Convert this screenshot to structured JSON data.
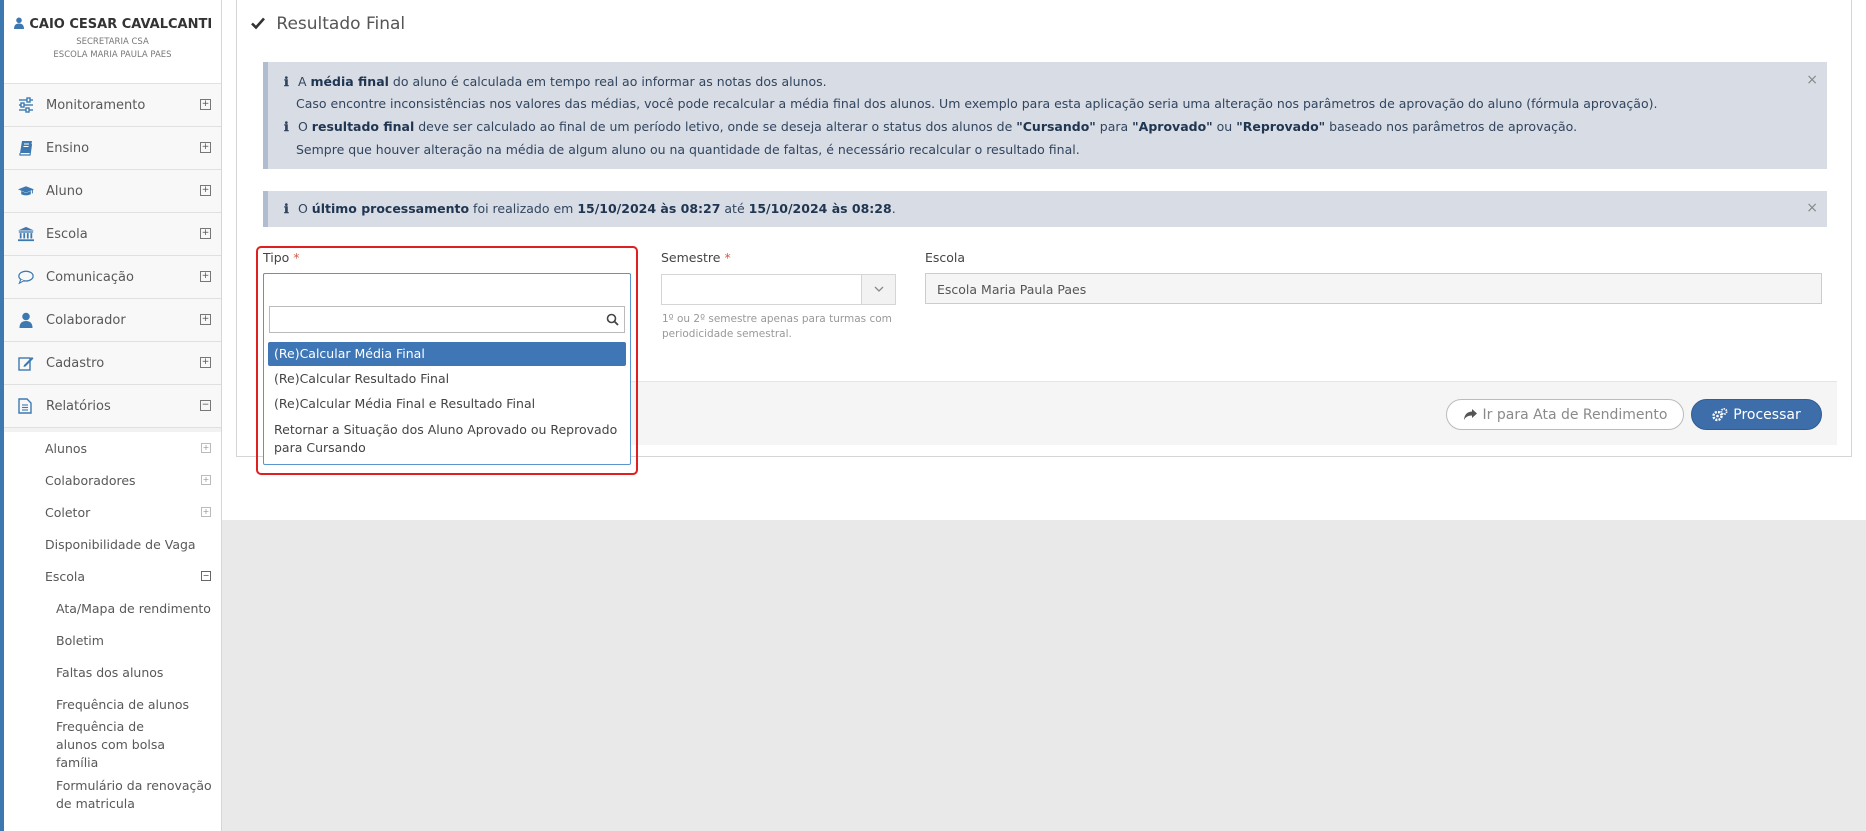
{
  "user": {
    "name": "CAIO CESAR CAVALCANTI",
    "role": "SECRETARIA CSA",
    "school": "ESCOLA MARIA PAULA PAES"
  },
  "sidebar": {
    "items": [
      {
        "label": "Monitoramento",
        "icon": "sliders-icon",
        "toggle": "⊞"
      },
      {
        "label": "Ensino",
        "icon": "book-icon",
        "toggle": "⊞"
      },
      {
        "label": "Aluno",
        "icon": "graduation-cap-icon",
        "toggle": "⊞"
      },
      {
        "label": "Escola",
        "icon": "bank-icon",
        "toggle": "⊞"
      },
      {
        "label": "Comunicação",
        "icon": "chat-bubble-icon",
        "toggle": "⊞"
      },
      {
        "label": "Colaborador",
        "icon": "user-icon",
        "toggle": "⊞"
      },
      {
        "label": "Cadastro",
        "icon": "edit-icon",
        "toggle": "⊞"
      },
      {
        "label": "Relatórios",
        "icon": "document-icon",
        "toggle": "⊟"
      }
    ],
    "reports": [
      {
        "label": "Alunos",
        "toggle": "+"
      },
      {
        "label": "Colaboradores",
        "toggle": "+"
      },
      {
        "label": "Coletor",
        "toggle": "+"
      },
      {
        "label": "Disponibilidade de Vaga"
      },
      {
        "label": "Escola",
        "toggle": "−"
      }
    ],
    "school_reports": [
      "Ata/Mapa de rendimento",
      "Boletim",
      "Faltas dos alunos",
      "Frequência de alunos",
      "Frequência de alunos com bolsa família",
      "Formulário da renovação de matricula"
    ]
  },
  "page": {
    "title": "Resultado Final"
  },
  "alert1": {
    "l1_pre": "A ",
    "l1_bold": "média final",
    "l1_post": " do aluno é calculada em tempo real ao informar as notas dos alunos.",
    "l2": "Caso encontre inconsistências nos valores das médias, você pode recalcular a média final dos alunos. Um exemplo para esta aplicação seria uma alteração nos parâmetros de aprovação do aluno (fórmula aprovação).",
    "l3_pre": "O ",
    "l3_bold": "resultado final",
    "l3_mid": " deve ser calculado ao final de um período letivo, onde se deseja alterar o status dos alunos de ",
    "l3_s1": "\"Cursando\"",
    "l3_para": " para ",
    "l3_s2": "\"Aprovado\"",
    "l3_ou": " ou ",
    "l3_s3": "\"Reprovado\"",
    "l3_end": " baseado nos parâmetros de aprovação.",
    "l4": "Sempre que houver alteração na média de algum aluno ou na quantidade de faltas, é necessário recalcular o resultado final.",
    "close": "×"
  },
  "alert2": {
    "pre": "O ",
    "bold": "último processamento",
    "mid": " foi realizado em ",
    "start": "15/10/2024 às 08:27",
    "ate": " até ",
    "end": "15/10/2024 às 08:28",
    "dot": ".",
    "close": "×"
  },
  "form": {
    "tipo_label": "Tipo",
    "semestre_label": "Semestre",
    "required_mark": "*",
    "escola_label": "Escola",
    "escola_value": "Escola Maria Paula Paes",
    "semestre_help_1": "1º ou 2º semestre apenas para turmas com",
    "semestre_help_2": "periodicidade semestral.",
    "tipo_search_placeholder": "",
    "tipo_options": [
      "(Re)Calcular Média Final",
      "(Re)Calcular Resultado Final",
      "(Re)Calcular Média Final e Resultado Final",
      "Retornar a Situação dos Aluno Aprovado ou Reprovado para Cursando"
    ]
  },
  "actions": {
    "ata_label": "Ir para Ata de Rendimento",
    "process_label": "Processar"
  }
}
